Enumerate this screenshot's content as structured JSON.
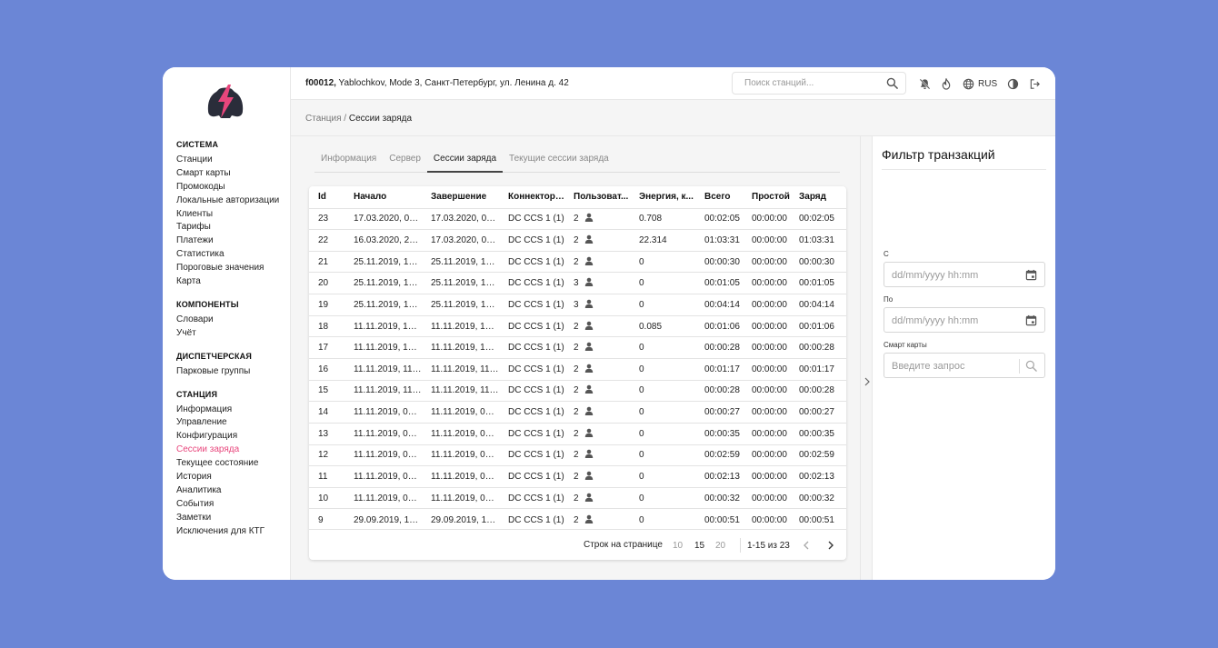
{
  "header": {
    "station_id": "f00012,",
    "station_desc": "Yablochkov, Mode 3, Санкт-Петербург, ул. Ленина д. 42",
    "search_placeholder": "Поиск станций...",
    "lang": "RUS"
  },
  "breadcrumb": {
    "root": "Станция",
    "sep": "/",
    "current": "Сессии заряда"
  },
  "sidebar": {
    "sections": [
      {
        "title": "СИСТЕМА",
        "items": [
          "Станции",
          "Смарт карты",
          "Промокоды",
          "Локальные авторизации",
          "Клиенты",
          "Тарифы",
          "Платежи",
          "Статистика",
          "Пороговые значения",
          "Карта"
        ]
      },
      {
        "title": "КОМПОНЕНТЫ",
        "items": [
          "Словари",
          "Учёт"
        ]
      },
      {
        "title": "ДИСПЕТЧЕРСКАЯ",
        "items": [
          "Парковые группы"
        ]
      },
      {
        "title": "СТАНЦИЯ",
        "items": [
          "Информация",
          "Управление",
          "Конфигурация",
          "Сессии заряда",
          "Текущее состояние",
          "История",
          "Аналитика",
          "События",
          "Заметки",
          "Исключения для КТГ"
        ]
      }
    ],
    "active_item": "Сессии заряда"
  },
  "tabs": {
    "items": [
      "Информация",
      "Сервер",
      "Сессии заряда",
      "Текущие сессии заряда"
    ],
    "active": "Сессии заряда"
  },
  "table": {
    "columns": [
      "Id",
      "Начало",
      "Завершение",
      "Коннектор ...",
      "Пользоват...",
      "Энергия, к...",
      "Всего",
      "Простой",
      "Заряд"
    ],
    "rows": [
      [
        "23",
        "17.03.2020, 00:...",
        "17.03.2020, 00:...",
        "DC CCS 1 (1)",
        "2",
        "0.708",
        "00:02:05",
        "00:00:00",
        "00:02:05"
      ],
      [
        "22",
        "16.03.2020, 23:...",
        "17.03.2020, 00:...",
        "DC CCS 1 (1)",
        "2",
        "22.314",
        "01:03:31",
        "00:00:00",
        "01:03:31"
      ],
      [
        "21",
        "25.11.2019, 12:...",
        "25.11.2019, 12:...",
        "DC CCS 1 (1)",
        "2",
        "0",
        "00:00:30",
        "00:00:00",
        "00:00:30"
      ],
      [
        "20",
        "25.11.2019, 12:...",
        "25.11.2019, 12:...",
        "DC CCS 1 (1)",
        "3",
        "0",
        "00:01:05",
        "00:00:00",
        "00:01:05"
      ],
      [
        "19",
        "25.11.2019, 12:...",
        "25.11.2019, 12:...",
        "DC CCS 1 (1)",
        "3",
        "0",
        "00:04:14",
        "00:00:00",
        "00:04:14"
      ],
      [
        "18",
        "11.11.2019, 12:...",
        "11.11.2019, 12:...",
        "DC CCS 1 (1)",
        "2",
        "0.085",
        "00:01:06",
        "00:00:00",
        "00:01:06"
      ],
      [
        "17",
        "11.11.2019, 12:...",
        "11.11.2019, 12:...",
        "DC CCS 1 (1)",
        "2",
        "0",
        "00:00:28",
        "00:00:00",
        "00:00:28"
      ],
      [
        "16",
        "11.11.2019, 11:...",
        "11.11.2019, 11:...",
        "DC CCS 1 (1)",
        "2",
        "0",
        "00:01:17",
        "00:00:00",
        "00:01:17"
      ],
      [
        "15",
        "11.11.2019, 11:...",
        "11.11.2019, 11:...",
        "DC CCS 1 (1)",
        "2",
        "0",
        "00:00:28",
        "00:00:00",
        "00:00:28"
      ],
      [
        "14",
        "11.11.2019, 08:...",
        "11.11.2019, 08:...",
        "DC CCS 1 (1)",
        "2",
        "0",
        "00:00:27",
        "00:00:00",
        "00:00:27"
      ],
      [
        "13",
        "11.11.2019, 08:...",
        "11.11.2019, 08:...",
        "DC CCS 1 (1)",
        "2",
        "0",
        "00:00:35",
        "00:00:00",
        "00:00:35"
      ],
      [
        "12",
        "11.11.2019, 07:...",
        "11.11.2019, 07:...",
        "DC CCS 1 (1)",
        "2",
        "0",
        "00:02:59",
        "00:00:00",
        "00:02:59"
      ],
      [
        "11",
        "11.11.2019, 07:...",
        "11.11.2019, 07:...",
        "DC CCS 1 (1)",
        "2",
        "0",
        "00:02:13",
        "00:00:00",
        "00:02:13"
      ],
      [
        "10",
        "11.11.2019, 07:...",
        "11.11.2019, 07:...",
        "DC CCS 1 (1)",
        "2",
        "0",
        "00:00:32",
        "00:00:00",
        "00:00:32"
      ],
      [
        "9",
        "29.09.2019, 18:...",
        "29.09.2019, 18:...",
        "DC CCS 1 (1)",
        "2",
        "0",
        "00:00:51",
        "00:00:00",
        "00:00:51"
      ]
    ]
  },
  "pagination": {
    "rows_per_page_label": "Строк на странице",
    "options": [
      "10",
      "15",
      "20"
    ],
    "selected": "15",
    "range": "1-15 из 23"
  },
  "filter": {
    "title": "Фильтр транзакций",
    "from_label": "С",
    "from_placeholder": "dd/mm/yyyy hh:mm",
    "to_label": "По",
    "to_placeholder": "dd/mm/yyyy hh:mm",
    "cards_label": "Смарт карты",
    "cards_placeholder": "Введите запрос"
  },
  "colors": {
    "background": "#6b86d6",
    "accent": "#e8467c",
    "logo_dark": "#2a2d3a"
  },
  "icons": [
    "logo-icon",
    "search-icon",
    "bell-off-icon",
    "fire-icon",
    "globe-icon",
    "theme-icon",
    "logout-icon",
    "person-icon",
    "calendar-icon",
    "chevron-left-icon",
    "chevron-right-icon"
  ]
}
